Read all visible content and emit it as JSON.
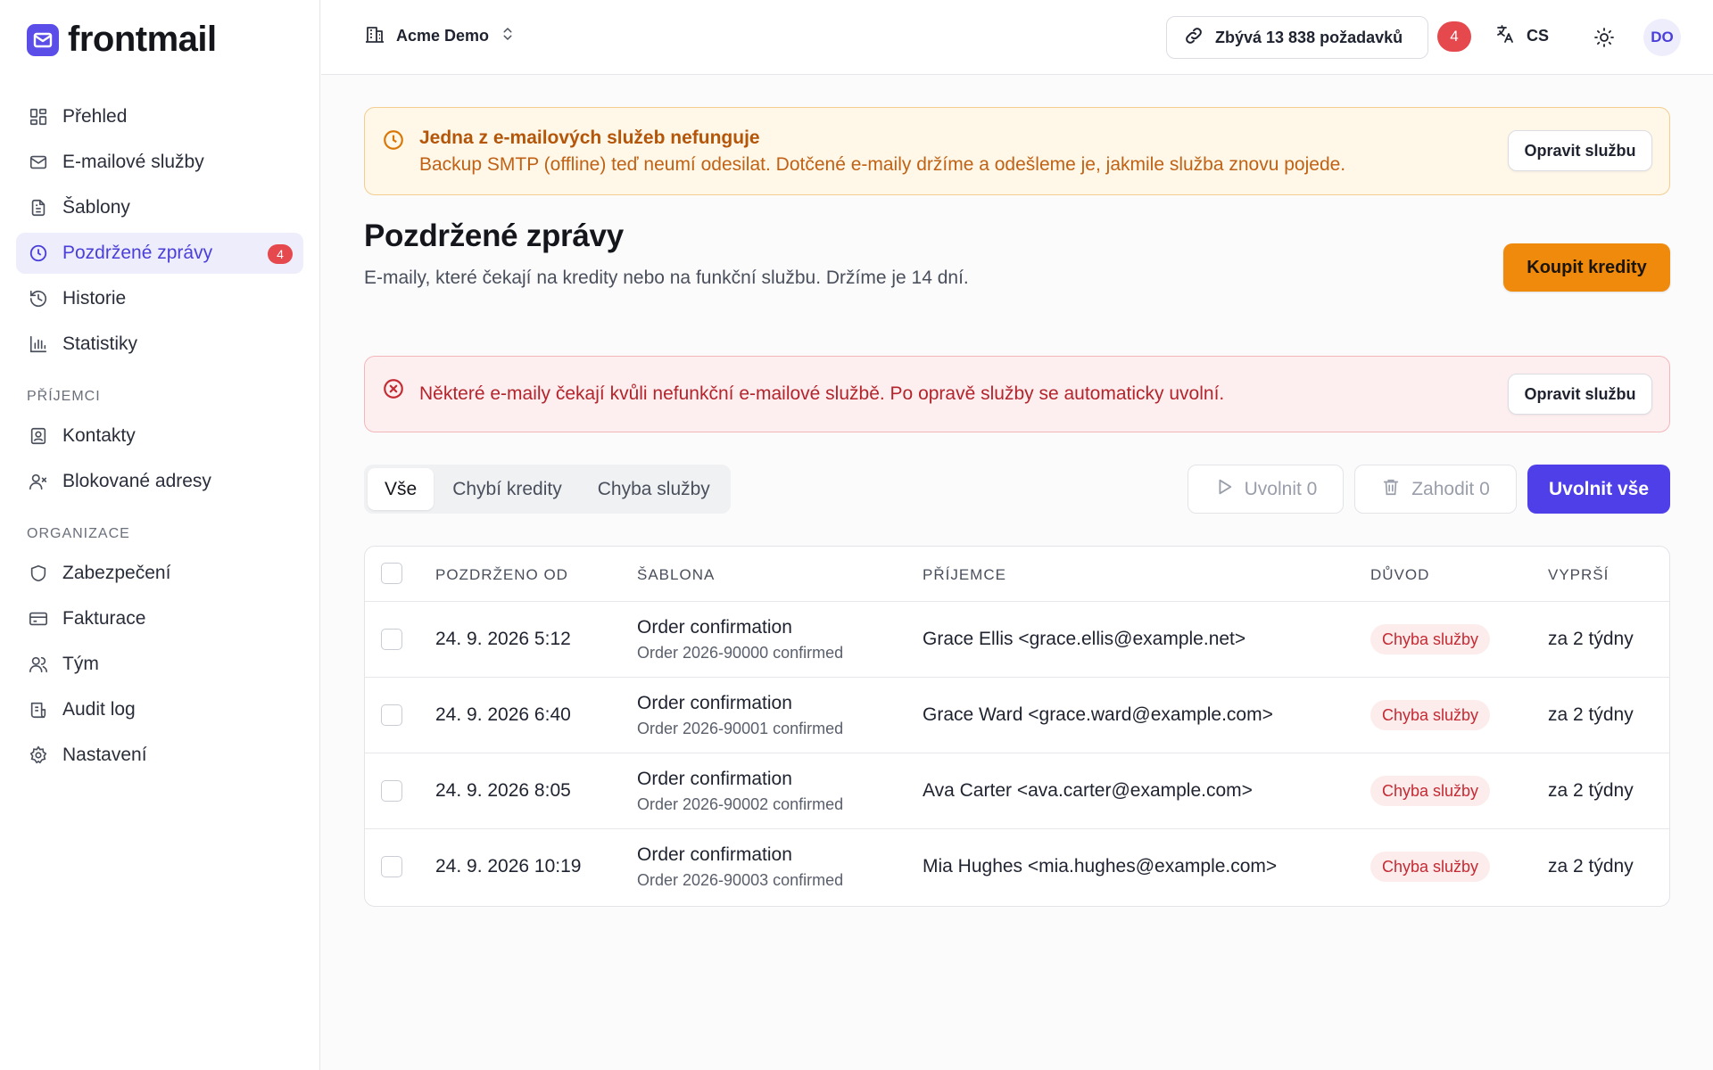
{
  "app": {
    "name": "frontmail"
  },
  "colors": {
    "accent": "#4f3fe8",
    "warning": "#f08a0c",
    "danger": "#e5484d"
  },
  "sidebar": {
    "items": [
      {
        "label": "Přehled",
        "icon": "grid-icon"
      },
      {
        "label": "E-mailové služby",
        "icon": "mail-icon"
      },
      {
        "label": "Šablony",
        "icon": "document-icon"
      },
      {
        "label": "Pozdržené zprávy",
        "icon": "clock-icon",
        "badge": "4",
        "active": true
      },
      {
        "label": "Historie",
        "icon": "history-icon"
      },
      {
        "label": "Statistiky",
        "icon": "bar-chart-icon"
      }
    ],
    "section_recipients": "PŘÍJEMCI",
    "recipients_items": [
      {
        "label": "Kontakty",
        "icon": "contact-icon"
      },
      {
        "label": "Blokované adresy",
        "icon": "user-block-icon"
      }
    ],
    "section_org": "ORGANIZACE",
    "org_items": [
      {
        "label": "Zabezpečení",
        "icon": "shield-icon"
      },
      {
        "label": "Fakturace",
        "icon": "credit-card-icon"
      },
      {
        "label": "Tým",
        "icon": "team-icon"
      },
      {
        "label": "Audit log",
        "icon": "audit-log-icon"
      },
      {
        "label": "Nastavení",
        "icon": "gear-icon"
      }
    ]
  },
  "topbar": {
    "org_name": "Acme Demo",
    "quota": "Zbývá 13 838 požadavků",
    "notifications": "4",
    "language": "CS",
    "avatar": "DO"
  },
  "warning_banner": {
    "title": "Jedna z e-mailových služeb nefunguje",
    "text": "Backup SMTP (offline) teď neumí odesilat. Dotčené e-maily držíme a odešleme je, jakmile služba znovu pojede.",
    "button": "Opravit službu"
  },
  "page": {
    "title": "Pozdržené zprávy",
    "subtitle": "E-maily, které čekají na kredity nebo na funkční službu. Držíme je 14 dní.",
    "buy_button": "Koupit kredity"
  },
  "error_banner": {
    "text": "Některé e-maily čekají kvůli nefunkční e-mailové službě. Po opravě služby se automaticky uvolní.",
    "button": "Opravit službu"
  },
  "tabs": [
    "Vše",
    "Chybí kredity",
    "Chyba služby"
  ],
  "actions": {
    "release": "Uvolnit 0",
    "discard": "Zahodit 0",
    "release_all": "Uvolnit vše"
  },
  "table": {
    "headers": [
      "POZDRŽENO OD",
      "ŠABLONA",
      "PŘÍJEMCE",
      "DŮVOD",
      "VYPRŠÍ"
    ],
    "rows": [
      {
        "date": "24. 9. 2026 5:12",
        "template": "Order confirmation",
        "template_sub": "Order 2026-90000 confirmed",
        "recipient": "Grace Ellis <grace.ellis@example.net>",
        "reason": "Chyba služby",
        "expires": "za 2 týdny"
      },
      {
        "date": "24. 9. 2026 6:40",
        "template": "Order confirmation",
        "template_sub": "Order 2026-90001 confirmed",
        "recipient": "Grace Ward <grace.ward@example.com>",
        "reason": "Chyba služby",
        "expires": "za 2 týdny"
      },
      {
        "date": "24. 9. 2026 8:05",
        "template": "Order confirmation",
        "template_sub": "Order 2026-90002 confirmed",
        "recipient": "Ava Carter <ava.carter@example.com>",
        "reason": "Chyba služby",
        "expires": "za 2 týdny"
      },
      {
        "date": "24. 9. 2026 10:19",
        "template": "Order confirmation",
        "template_sub": "Order 2026-90003 confirmed",
        "recipient": "Mia Hughes <mia.hughes@example.com>",
        "reason": "Chyba služby",
        "expires": "za 2 týdny"
      }
    ]
  }
}
